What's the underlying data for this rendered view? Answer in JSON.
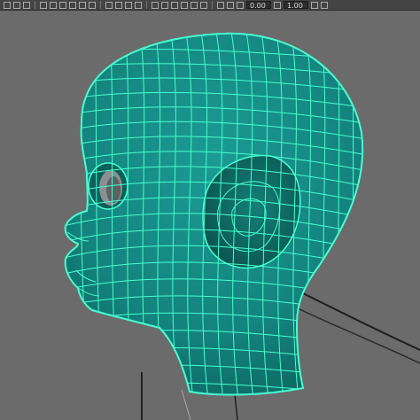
{
  "toolbar": {
    "field_1": "0.00",
    "field_2": "1.00"
  },
  "viewport": {
    "label": "",
    "colors": {
      "background": "#6b6b6b",
      "mesh_fill": "#14837d",
      "mesh_shade": "#0b5d58",
      "wire": "#47ffd0",
      "curve": "#1e1e1e"
    }
  }
}
